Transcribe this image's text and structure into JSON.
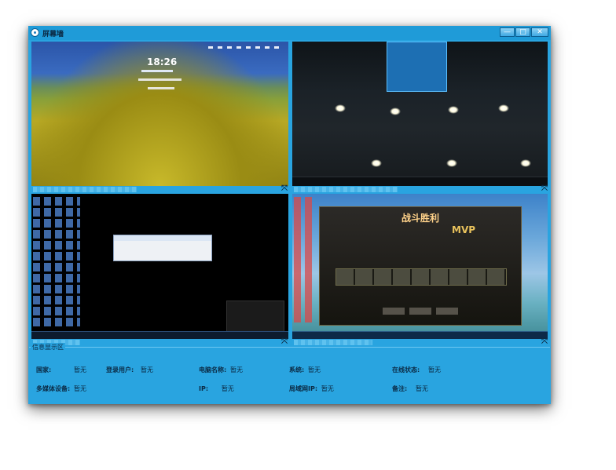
{
  "window": {
    "title": "屏幕墙"
  },
  "titlebar_buttons": {
    "minimize": "—",
    "maximize": "□",
    "close": "✕"
  },
  "screens": [
    {
      "clock": "18:26"
    },
    {},
    {},
    {
      "game_title": "战斗胜利",
      "mvp": "MVP"
    }
  ],
  "info": {
    "legend": "信息显示区",
    "fields": [
      {
        "label": "国家:",
        "value": "暂无"
      },
      {
        "label": "登录用户:",
        "value": "暂无"
      },
      {
        "label": "电脑名称:",
        "value": "暂无"
      },
      {
        "label": "系统:",
        "value": "暂无"
      },
      {
        "label": "在线状态:",
        "value": "暂无"
      },
      {
        "label": "多媒体设备:",
        "value": "暂无"
      },
      {
        "label": "IP:",
        "value": "暂无"
      },
      {
        "label": "局域网IP:",
        "value": "暂无"
      },
      {
        "label": "备注:",
        "value": "暂无"
      }
    ]
  },
  "colors": {
    "window_bg": "#29a4e0",
    "titlebar": "#1f9bd8",
    "text": "#0b2a44"
  }
}
